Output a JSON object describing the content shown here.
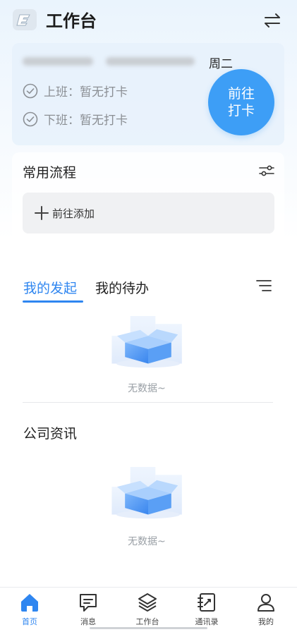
{
  "header": {
    "title": "工作台",
    "logo_icon": "brand-logo-icon",
    "switch_icon": "switch-arrows-icon"
  },
  "attendance": {
    "weekday": "周二",
    "clock_in": "上班：暂无打卡",
    "clock_out": "下班：暂无打卡",
    "punch_button": "前往\n打卡"
  },
  "processes": {
    "title": "常用流程",
    "add_label": "前往添加"
  },
  "tabs": [
    {
      "label": "我的发起",
      "active": true
    },
    {
      "label": "我的待办",
      "active": false
    }
  ],
  "empty_text": "无数据~",
  "news": {
    "title": "公司资讯",
    "empty_text": "无数据~"
  },
  "nav": [
    {
      "label": "首页",
      "icon": "home-icon",
      "active": true
    },
    {
      "label": "消息",
      "icon": "message-icon",
      "active": false
    },
    {
      "label": "工作台",
      "icon": "layers-icon",
      "active": false
    },
    {
      "label": "通讯录",
      "icon": "contacts-icon",
      "active": false
    },
    {
      "label": "我的",
      "icon": "user-icon",
      "active": false
    }
  ],
  "colors": {
    "accent": "#2f86f0",
    "punch_button": "#3d9ef6"
  }
}
